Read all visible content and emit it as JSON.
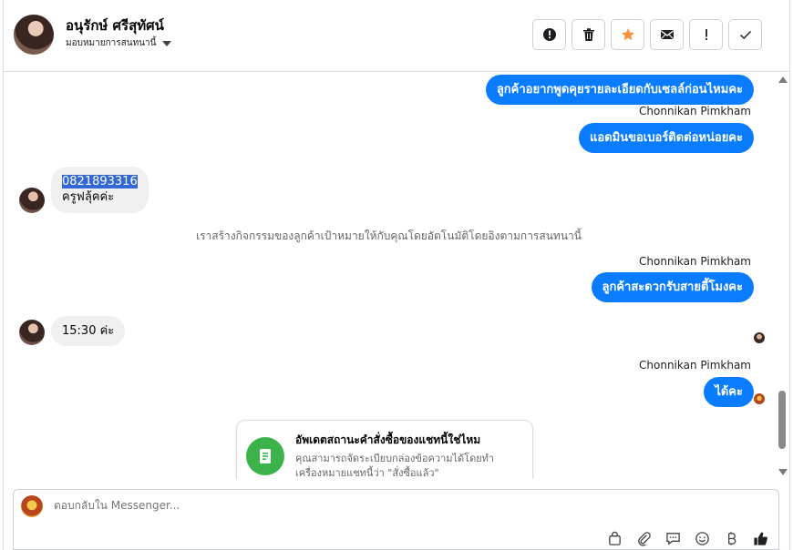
{
  "header": {
    "contact_name": "อนุรักษ์ ศรีสุทัศน์",
    "assign_label": "มอบหมายการสนทนานี้",
    "actions": [
      "mark-spam",
      "delete",
      "star",
      "mark-unread",
      "important",
      "done"
    ]
  },
  "messages": {
    "m1": "ลูกค้าอยากพูดคุยรายละเอียดกับเซลล์ก่อนไหมคะ",
    "sender1": "Chonnikan Pimkham",
    "m2": "แอดมินขอเบอร์ติดต่อหน่อยคะ",
    "in1_phone": "0821893316",
    "in1_name": "ครูฟลุ้คค่ะ",
    "system1": "เราสร้างกิจกรรมของลูกค้าเป้าหมายให้กับคุณโดยอัตโนมัติโดยอิงตามการสนทนานี้",
    "sender2": "Chonnikan Pimkham",
    "m3": "ลูกค้าสะดวกรับสายตี้โมงคะ",
    "in2": "15:30 ค่ะ",
    "sender3": "Chonnikan Pimkham",
    "m4": "ได้คะ"
  },
  "card": {
    "title": "อัพเดตสถานะคำสั่งซื้อของแชทนี้ใช่ไหม",
    "body": "คุณสามารถจัดระเบียบกล่องข้อความได้โดยทำเครื่องหมายแชทนี้ว่า \"สั่งซื้อแล้ว\""
  },
  "composer": {
    "placeholder": "ตอบกลับใน Messenger..."
  },
  "colors": {
    "outgoing": "#0a7cff",
    "incoming": "#f0f0f0",
    "star": "#f7923a",
    "card_icon": "#3bb34a"
  }
}
